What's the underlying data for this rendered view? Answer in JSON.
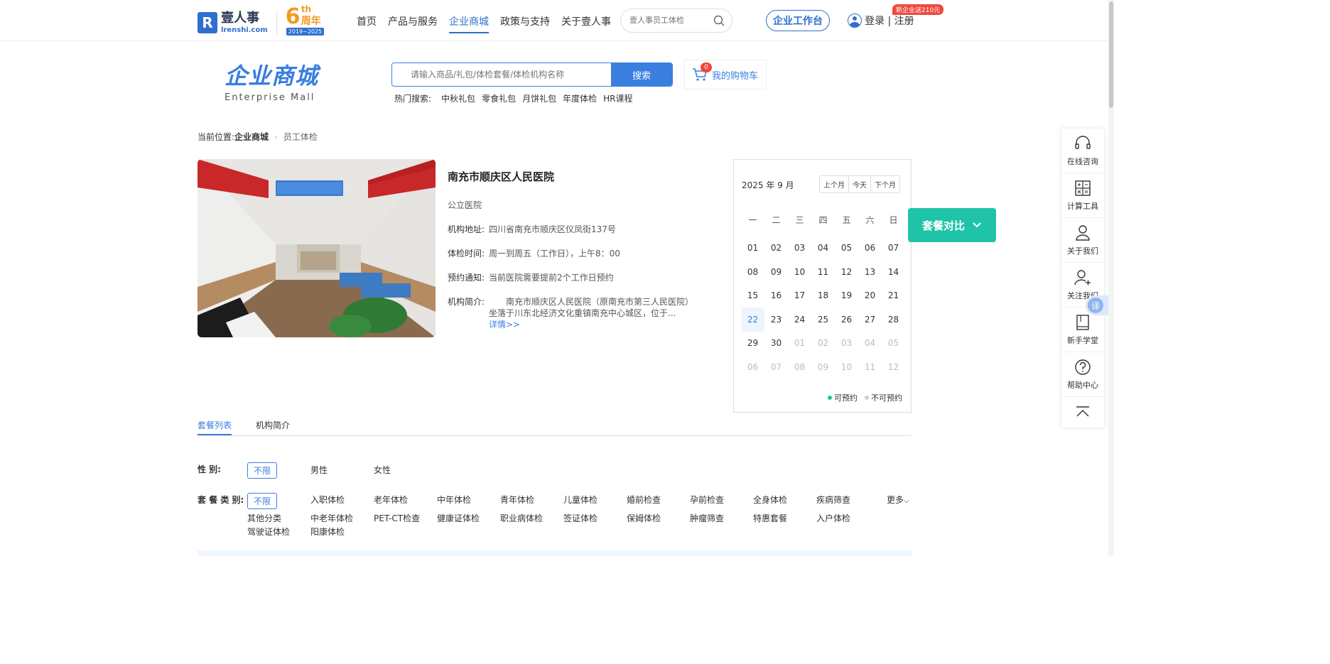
{
  "header": {
    "logo_cn": "壹人事",
    "logo_en": "lrenshi.com",
    "anniv_num": "6",
    "anniv_th": "th",
    "anniv_cn": "周年",
    "anniv_years": "2019~2025",
    "nav": [
      "首页",
      "产品与服务",
      "企业商城",
      "政策与支持",
      "关于壹人事"
    ],
    "search_placeholder": "壹人事员工体检",
    "workbench": "企业工作台",
    "login": "登录 | 注册",
    "promo": "新企业送210元"
  },
  "mall": {
    "title_cn": "企业商城",
    "title_en": "Enterprise  Mall",
    "search_placeholder": "请输入商品/礼包/体检套餐/体检机构名称",
    "search_button": "搜索",
    "hot_label": "热门搜索:",
    "hot_items": [
      "中秋礼包",
      "零食礼包",
      "月饼礼包",
      "年度体检",
      "HR课程"
    ],
    "cart_label": "我的购物车",
    "cart_count": "0"
  },
  "breadcrumb": {
    "prefix": "当前位置:",
    "current": "企业商城",
    "leaf": "员工体检"
  },
  "hospital": {
    "name": "南充市顺庆区人民医院",
    "type": "公立医院",
    "address_label": "机构地址:",
    "address": "四川省南充市顺庆区仪凤街137号",
    "hours_label": "体检时间:",
    "hours": "周一到周五（工作日），上午8：00",
    "notice_label": "预约通知:",
    "notice": "当前医院需要提前2个工作日预约",
    "intro_label": "机构简介:",
    "intro": "南充市顺庆区人民医院（原南充市第三人民医院）坐落于川东北经济文化重镇南充中心城区，位于...",
    "more": "详情>>"
  },
  "calendar": {
    "year_month": "2025 年 9 月",
    "buttons": [
      "上个月",
      "今天",
      "下个月"
    ],
    "weekdays": [
      "一",
      "二",
      "三",
      "四",
      "五",
      "六",
      "日"
    ],
    "days": [
      [
        "01",
        "02",
        "03",
        "04",
        "05",
        "06",
        "07"
      ],
      [
        "08",
        "09",
        "10",
        "11",
        "12",
        "13",
        "14"
      ],
      [
        "15",
        "16",
        "17",
        "18",
        "19",
        "20",
        "21"
      ],
      [
        "22",
        "23",
        "24",
        "25",
        "26",
        "27",
        "28"
      ],
      [
        "29",
        "30",
        "01",
        "02",
        "03",
        "04",
        "05"
      ],
      [
        "06",
        "07",
        "08",
        "09",
        "10",
        "11",
        "12"
      ]
    ],
    "today": "22",
    "legend_available": "可预约",
    "legend_unavailable": "不可预约",
    "color_available": "#1fc4a8",
    "color_unavailable": "#cccccc"
  },
  "compare_button": "套餐对比",
  "sidebar": [
    "在线咨询",
    "计算工具",
    "关于我们",
    "关注我们",
    "新手学堂",
    "帮助中心"
  ],
  "translate": "译",
  "tabs": [
    "套餐列表",
    "机构简介"
  ],
  "filters": {
    "gender_label": "性      别:",
    "gender_options": [
      "不限",
      "男性",
      "女性"
    ],
    "category_label": "套 餐 类 别:",
    "category_selected": "不限",
    "category_row1": [
      "入职体检",
      "老年体检",
      "中年体检",
      "青年体检",
      "儿童体检",
      "婚前检查",
      "孕前检查",
      "全身体检",
      "疾病筛查"
    ],
    "category_row2": [
      "其他分类",
      "中老年体检",
      "PET-CT检查",
      "健康证体检",
      "职业病体检",
      "签证体检",
      "保姆体检",
      "肿瘤筛查",
      "特惠套餐",
      "入户体检"
    ],
    "category_row3": [
      "驾驶证体检",
      "阳康体检"
    ],
    "more": "更多"
  }
}
